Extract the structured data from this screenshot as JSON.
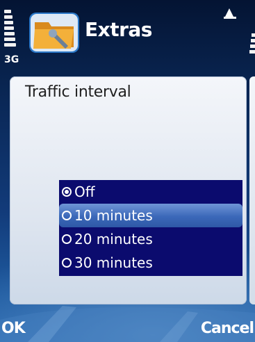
{
  "status": {
    "network": "3G",
    "app_title": "Extras",
    "app_icon": "folder-tools-icon",
    "indicator_icon": "signal-indicator-icon"
  },
  "dialog": {
    "heading": "Traffic interval",
    "options": [
      {
        "label": "Off",
        "checked": true,
        "highlighted": false
      },
      {
        "label": "10 minutes",
        "checked": false,
        "highlighted": true
      },
      {
        "label": "20 minutes",
        "checked": false,
        "highlighted": false
      },
      {
        "label": "30 minutes",
        "checked": false,
        "highlighted": false
      }
    ]
  },
  "softkeys": {
    "left": "OK",
    "right": "Cancel"
  },
  "colors": {
    "list_background": "#0b0b6e",
    "highlight": "#3b68b9",
    "background": "#0a2857"
  }
}
